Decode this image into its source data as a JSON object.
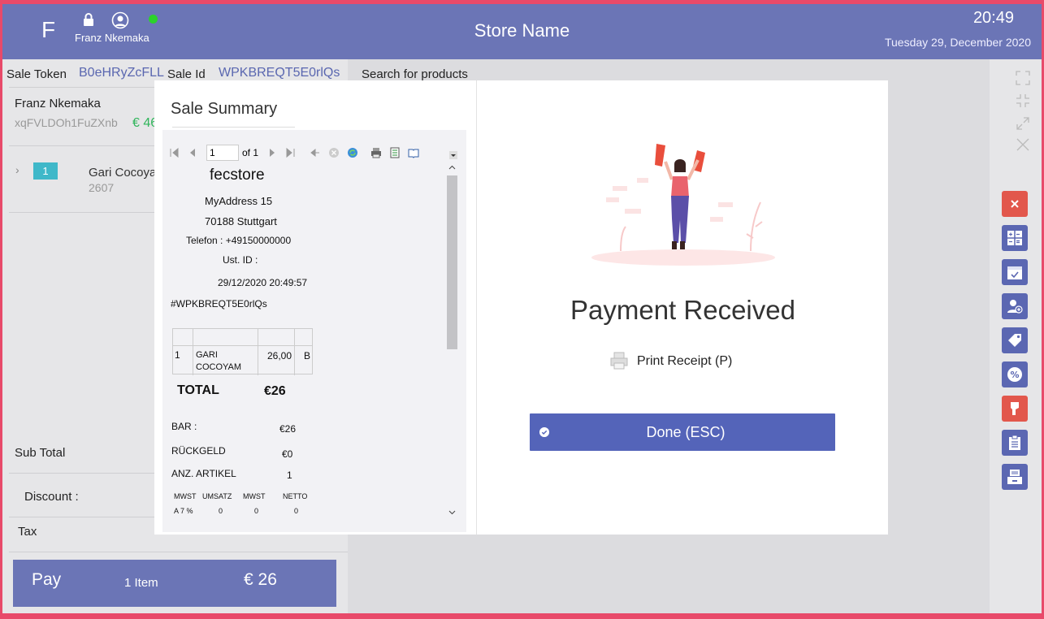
{
  "header": {
    "logo": "F",
    "user": "Franz Nkemaka",
    "store": "Store Name",
    "time": "20:49",
    "date": "Tuesday 29, December  2020"
  },
  "sale": {
    "token_label": "Sale Token",
    "token_value": "B0eHRyZcFLL",
    "id_label": "Sale  Id",
    "id_value": "WPKBREQT5E0rlQs"
  },
  "search": {
    "label": "Search for products"
  },
  "customer": {
    "name": "Franz  Nkemaka",
    "id": "xqFVLDOh1FuZXnb",
    "amount": "€ 46"
  },
  "cart": {
    "items": [
      {
        "qty": "1",
        "name": "Gari Cocoya",
        "code": "2607"
      }
    ]
  },
  "summary": {
    "subtotal_label": "Sub Total",
    "discount_label": "Discount :",
    "tax_label": "Tax"
  },
  "pay": {
    "label": "Pay",
    "count": "1 Item",
    "total": "€ 26"
  },
  "modal": {
    "summary_title": "Sale Summary",
    "viewer": {
      "page": "1",
      "of_label": "of",
      "pages": "1"
    },
    "receipt": {
      "store": "fecstore",
      "address1": "MyAddress 15",
      "address2": "70188 Stuttgart",
      "phone": "Telefon : +49150000000",
      "vat": "Ust. ID :",
      "datetime": "29/12/2020 20:49:57",
      "number": "#WPKBREQT5E0rlQs",
      "line": {
        "qty": "1",
        "name1": "GARI",
        "name2": "COCOYAM",
        "price": "26,00",
        "tax": "B"
      },
      "total_label": "TOTAL",
      "total_value": "€26",
      "cash_label": "BAR :",
      "cash_value": "€26",
      "change_label": "RÜCKGELD",
      "change_value": "€0",
      "count_label": "ANZ. ARTIKEL",
      "count_value": "1",
      "tax_headers": [
        "MWST",
        "UMSATZ",
        "MWST",
        "NETTO"
      ],
      "tax_row": [
        "A 7 %",
        "0",
        "0",
        "0"
      ]
    },
    "payment_title": "Payment Received",
    "print_label": "Print Receipt (P)",
    "done_label": "Done (ESC)"
  },
  "colors": {
    "header": "#6b75b6",
    "accent": "#5464b9",
    "badge": "#3fb8c9",
    "online": "#2bd22b",
    "danger": "#e2574c"
  }
}
